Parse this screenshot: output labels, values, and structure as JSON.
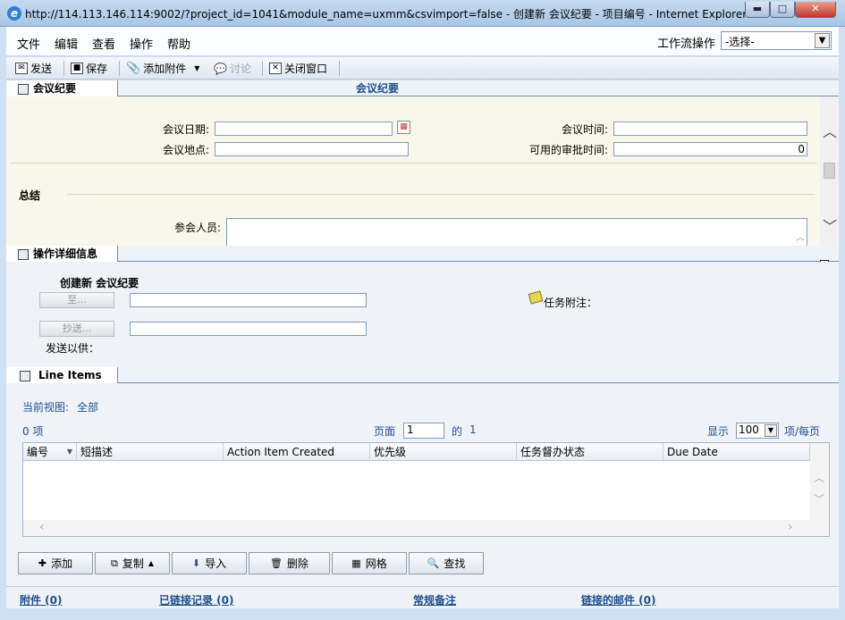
{
  "window": {
    "title": "http://114.113.146.114:9002/?project_id=1041&module_name=uxmm&csvimport=false - 创建新 会议纪要 - 项目编号 - Internet Explorer",
    "minimize": "▬",
    "maximize": "□",
    "close": "✕"
  },
  "menu": {
    "items": [
      "文件",
      "编辑",
      "查看",
      "操作",
      "帮助"
    ],
    "workflow_label": "工作流操作",
    "workflow_value": "-选择-"
  },
  "toolbar": {
    "send": "发送",
    "save": "保存",
    "attach": "添加附件",
    "discuss": "讨论",
    "close_window": "关闭窗口"
  },
  "meeting": {
    "tab_label": "会议纪要",
    "center_title": "会议纪要",
    "date_label": "会议日期:",
    "date_value": "",
    "time_label": "会议时间:",
    "time_value": "",
    "location_label": "会议地点:",
    "location_value": "",
    "approval_label": "可用的审批时间:",
    "approval_value": "0",
    "summary_label": "总结",
    "attendees_label": "参会人员:"
  },
  "operation": {
    "tab_label": "操作详细信息",
    "heading": "创建新 会议纪要",
    "to_button": "至...",
    "cc_button": "抄送...",
    "fyi_label": "发送以供：",
    "task_note_label": "任务附注："
  },
  "line_items": {
    "tab_label": "Line Items",
    "current_view_label": "当前视图:",
    "current_view_value": "全部",
    "count": "0 项",
    "page_label": "页面",
    "page_value": "1",
    "of_label": "的",
    "of_value": "1",
    "show_label": "显示",
    "per_page_value": "100",
    "per_page_label": "项/每页",
    "columns": [
      "编号",
      "短描述",
      "Action Item Created",
      "优先级",
      "任务督办状态",
      "Due Date"
    ],
    "actions": [
      "添加",
      "复制",
      "导入",
      "删除",
      "网格",
      "查找"
    ]
  },
  "footer_links": {
    "attachments": "附件 (0)",
    "linked_records": "已链接记录 (0)",
    "notes": "常规备注",
    "linked_mail": "链接的邮件 (0)"
  }
}
